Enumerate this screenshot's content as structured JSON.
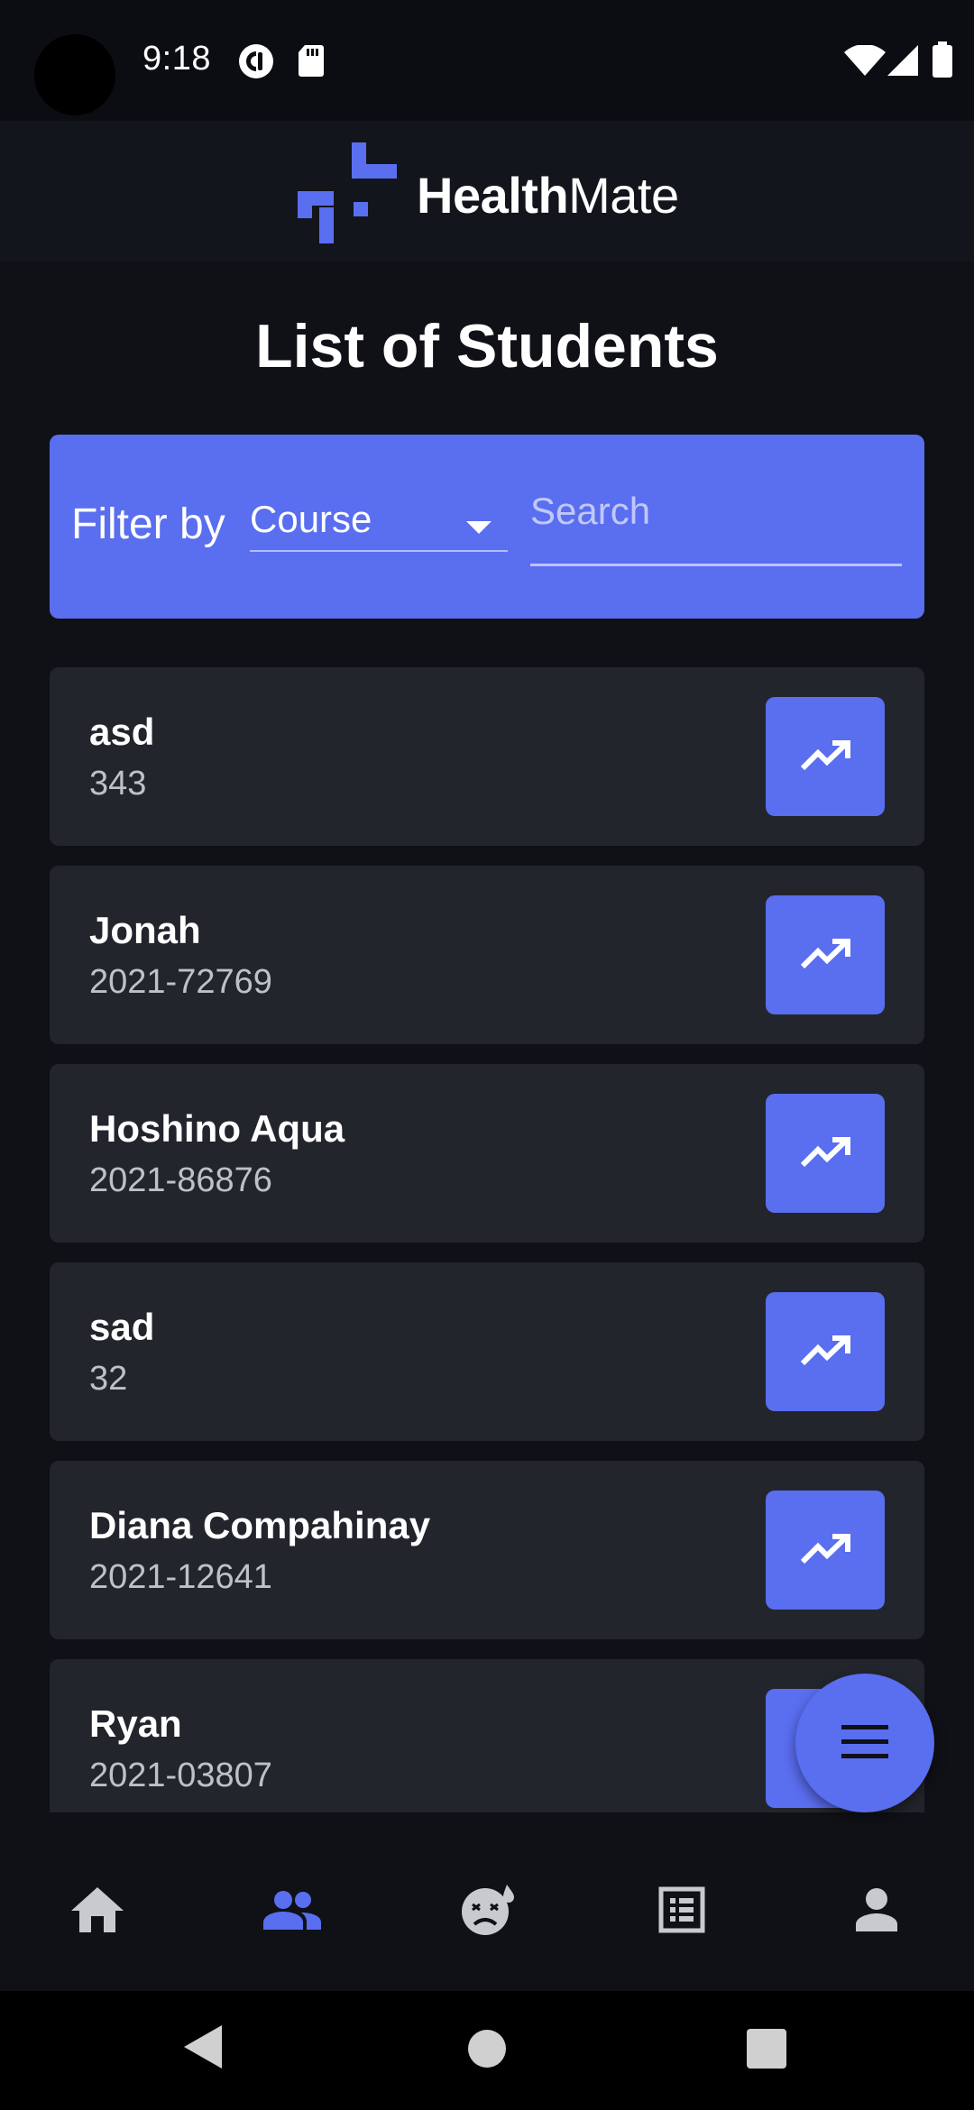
{
  "status_bar": {
    "time": "9:18",
    "left_icons": [
      "pocket-casts-icon",
      "sd-card-icon"
    ],
    "right_icons": [
      "wifi-icon",
      "signal-icon",
      "battery-icon"
    ]
  },
  "header": {
    "brand_bold": "Health",
    "brand_regular": "Mate",
    "logo_icon": "healthmate-logo-icon",
    "accent_color": "#5a6ef0"
  },
  "page": {
    "title": "List of Students"
  },
  "filter": {
    "label": "Filter by",
    "selected_option": "Course",
    "search_placeholder": "Search",
    "search_value": ""
  },
  "students": [
    {
      "name": "asd",
      "id": "343"
    },
    {
      "name": "Jonah",
      "id": "2021-72769"
    },
    {
      "name": "Hoshino Aqua",
      "id": "2021-86876"
    },
    {
      "name": "sad",
      "id": "32"
    },
    {
      "name": "Diana Compahinay",
      "id": "2021-12641"
    },
    {
      "name": "Ryan",
      "id": "2021-03807"
    }
  ],
  "fab": {
    "icon": "menu-icon"
  },
  "bottom_nav": {
    "items": [
      {
        "icon": "home-icon",
        "active": false
      },
      {
        "icon": "people-icon",
        "active": true
      },
      {
        "icon": "sick-face-icon",
        "active": false
      },
      {
        "icon": "list-alt-icon",
        "active": false
      },
      {
        "icon": "person-icon",
        "active": false
      }
    ],
    "active_color": "#5a6ef0",
    "inactive_color": "#c8cad0"
  },
  "system_nav": {
    "icons": [
      "back-icon",
      "home-circle-icon",
      "recents-icon"
    ]
  }
}
